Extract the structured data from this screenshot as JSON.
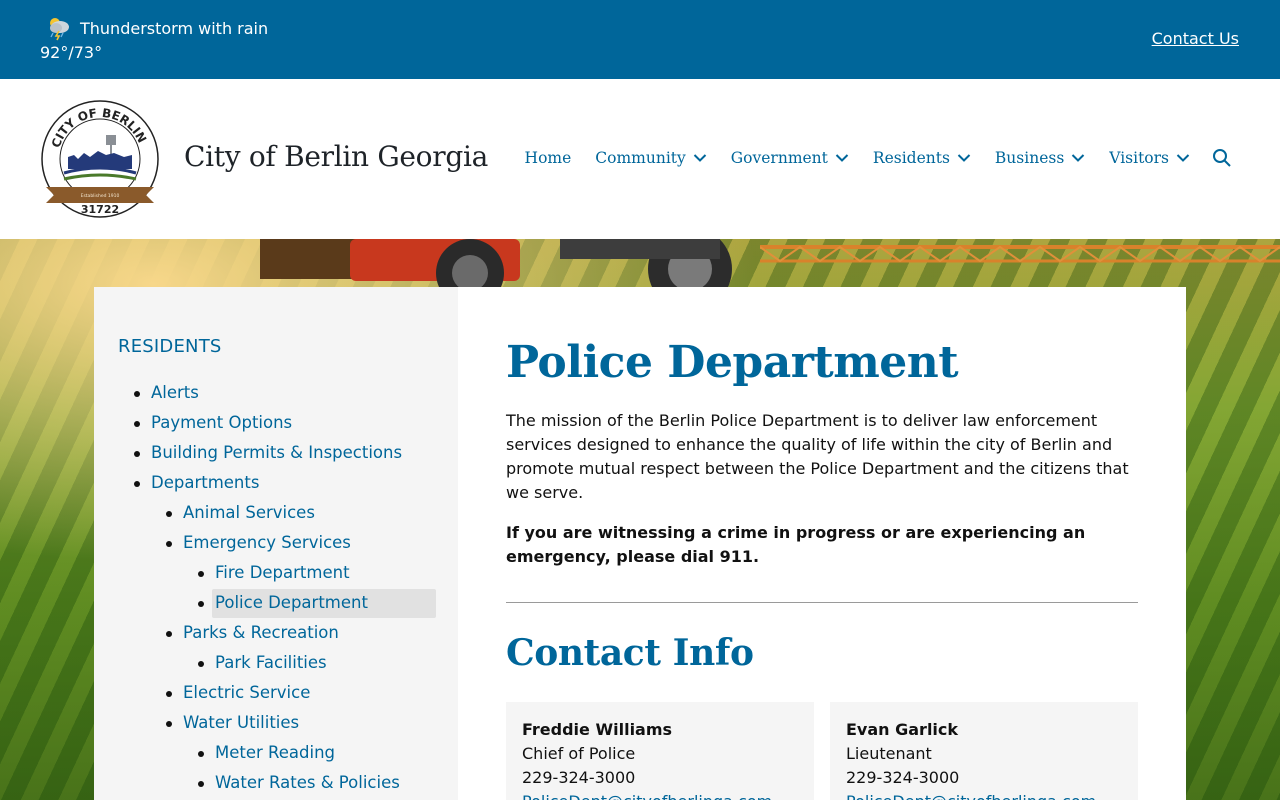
{
  "weather": {
    "condition": "Thunderstorm with rain",
    "temps": "92°/73°",
    "icon": "thunderstorm-rain-icon"
  },
  "topbar": {
    "contact_label": "Contact Us"
  },
  "header": {
    "site_title": "City of Berlin Georgia",
    "logo": {
      "ring_text": "CITY OF BERLIN",
      "zip": "31722",
      "established": "Established 1910"
    },
    "nav": [
      "Home",
      "Community",
      "Government",
      "Residents",
      "Business",
      "Visitors"
    ]
  },
  "sidebar": {
    "heading": "RESIDENTS",
    "items": [
      {
        "label": "Alerts",
        "level": 0
      },
      {
        "label": "Payment Options",
        "level": 0
      },
      {
        "label": "Building Permits & Inspections",
        "level": 0
      },
      {
        "label": "Departments",
        "level": 0
      },
      {
        "label": "Animal Services",
        "level": 1
      },
      {
        "label": "Emergency Services",
        "level": 1
      },
      {
        "label": "Fire Department",
        "level": 2
      },
      {
        "label": "Police Department",
        "level": 2,
        "active": true
      },
      {
        "label": "Parks & Recreation",
        "level": 1
      },
      {
        "label": "Park Facilities",
        "level": 2
      },
      {
        "label": "Electric Service",
        "level": 1
      },
      {
        "label": "Water Utilities",
        "level": 1
      },
      {
        "label": "Meter Reading",
        "level": 2
      },
      {
        "label": "Water Rates & Policies",
        "level": 2
      }
    ]
  },
  "main": {
    "title": "Police Department",
    "mission": "The mission of the Berlin Police Department is to deliver law enforcement services designed to enhance the quality of life within the city of Berlin and promote mutual respect between the Police Department and the citizens that we serve.",
    "emergency": "If you are witnessing a crime in progress or are experiencing an emergency, please dial 911.",
    "contact_heading": "Contact Info",
    "contacts": [
      {
        "name": "Freddie Williams",
        "role": "Chief of Police",
        "phone": "229-324-3000",
        "email": "PoliceDept@cityofberlinga.com"
      },
      {
        "name": "Evan Garlick",
        "role": "Lieutenant",
        "phone": "229-324-3000",
        "email": "PoliceDept@cityofberlinga.com"
      }
    ]
  },
  "colors": {
    "brand": "#00669a",
    "sidebar_bg": "#f5f5f5",
    "active_bg": "#e1e1e1"
  }
}
